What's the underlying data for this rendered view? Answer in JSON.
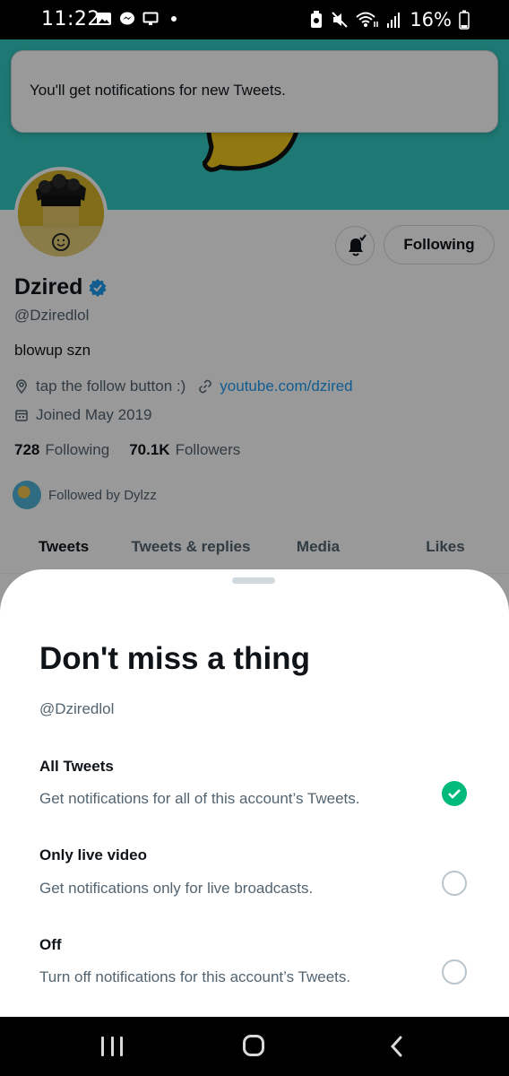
{
  "status_bar": {
    "time": "11:22",
    "battery": "16%"
  },
  "toast": {
    "text": "You'll get notifications for new Tweets."
  },
  "profile": {
    "name": "Dzired",
    "handle": "@Dziredlol",
    "bio": "blowup szn",
    "location": "tap the follow button :)",
    "website": "youtube.com/dzired",
    "joined": "Joined May 2019",
    "following_count": "728",
    "following_label": "Following",
    "followers_count": "70.1K",
    "followers_label": "Followers",
    "followed_by": "Followed by Dylzz",
    "follow_button": "Following"
  },
  "tabs": [
    {
      "label": "Tweets",
      "active": true
    },
    {
      "label": "Tweets & replies",
      "active": false
    },
    {
      "label": "Media",
      "active": false
    },
    {
      "label": "Likes",
      "active": false
    }
  ],
  "sheet": {
    "title": "Don't miss a thing",
    "handle": "@Dziredlol",
    "options": [
      {
        "title": "All Tweets",
        "desc": "Get notifications for all of this account’s Tweets.",
        "selected": true
      },
      {
        "title": "Only live video",
        "desc": "Get notifications only for live broadcasts.",
        "selected": false
      },
      {
        "title": "Off",
        "desc": "Turn off notifications for this account’s Tweets.",
        "selected": false
      }
    ]
  },
  "colors": {
    "banner": "#33c8c0",
    "accent": "#1d9bf0",
    "selected": "#00ba7c"
  }
}
